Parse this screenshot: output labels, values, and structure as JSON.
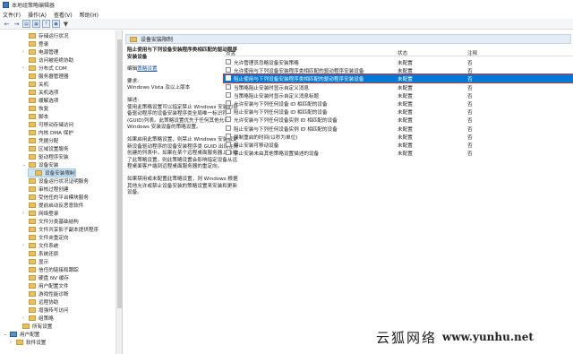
{
  "window": {
    "title": "本地组策略编辑器"
  },
  "menu": [
    "文件(F)",
    "操作(A)",
    "查看(V)",
    "帮助(H)"
  ],
  "toolbar": {
    "back": "←",
    "forward": "→",
    "box1": "▤",
    "box2": "▦",
    "help": "?",
    "box3": "▣",
    "filter": "▼"
  },
  "tree": {
    "items": [
      {
        "label": "存储运行状况",
        "depth": 3
      },
      {
        "label": "登录",
        "depth": 3
      },
      {
        "label": "电源管理",
        "depth": 3,
        "toggle": "›"
      },
      {
        "label": "访问被拒绝协助",
        "depth": 3
      },
      {
        "label": "分布式 COM",
        "depth": 3,
        "toggle": "›"
      },
      {
        "label": "服务器管理器",
        "depth": 3
      },
      {
        "label": "关机",
        "depth": 3
      },
      {
        "label": "关机选项",
        "depth": 3
      },
      {
        "label": "缓解选项",
        "depth": 3
      },
      {
        "label": "恢复",
        "depth": 3
      },
      {
        "label": "脚本",
        "depth": 3
      },
      {
        "label": "可移动存储访问",
        "depth": 3
      },
      {
        "label": "内核 DMA 保护",
        "depth": 3
      },
      {
        "label": "凭据分配",
        "depth": 3
      },
      {
        "label": "区域设置服务",
        "depth": 3
      },
      {
        "label": "驱动程序安装",
        "depth": 3
      },
      {
        "label": "设备安装",
        "depth": 3,
        "toggle": "⌄"
      },
      {
        "label": "设备安装限制",
        "depth": 4,
        "selected": true
      },
      {
        "label": "设备运行状况证明服务",
        "depth": 3
      },
      {
        "label": "审核过程创建",
        "depth": 3
      },
      {
        "label": "受信任的平台模块服务",
        "depth": 3
      },
      {
        "label": "提前启动反恶意软件",
        "depth": 3
      },
      {
        "label": "网络登录",
        "depth": 3,
        "toggle": "›"
      },
      {
        "label": "文件分类基础结构",
        "depth": 3
      },
      {
        "label": "文件共享影子副本提供程序",
        "depth": 3
      },
      {
        "label": "文件夹重定向",
        "depth": 3
      },
      {
        "label": "文件系统",
        "depth": 3,
        "toggle": "›"
      },
      {
        "label": "系统还原",
        "depth": 3
      },
      {
        "label": "显示",
        "depth": 3
      },
      {
        "label": "信任的链接和跟踪",
        "depth": 3
      },
      {
        "label": "硬盘 NV 缓存",
        "depth": 3
      },
      {
        "label": "用户配置文件",
        "depth": 3
      },
      {
        "label": "游戏性能诊断",
        "depth": 3
      },
      {
        "label": "远程协助",
        "depth": 3
      },
      {
        "label": "增强传写访问",
        "depth": 3
      },
      {
        "label": "组策略",
        "depth": 3,
        "toggle": "›"
      },
      {
        "label": "所有设置",
        "depth": 2
      },
      {
        "label": "用户配置",
        "depth": 0,
        "toggle": "⌄",
        "pc": true
      },
      {
        "label": "软件设置",
        "depth": 1,
        "toggle": "›"
      }
    ]
  },
  "content": {
    "header": "设备安装限制",
    "desc": {
      "title": "阻止使用与下列设备安装程序类相匹配的驱动程序安装设备",
      "edit_prefix": "编辑",
      "edit_link": "策略设置",
      "req_label": "要求:",
      "req_text": "Windows Vista 及以上版本",
      "desc_label": "描述:",
      "desc_text": "使用此策略设置可以指定禁止 Windows 安装的设备驱动程序的设备安装程序类全局唯一标识符(GUID)列表。此策略设置优先于任何其他允许 Windows 安装设备的策略设置。",
      "enable_text": "如果启用此策略设置，则禁止 Windows 安装或更新设备驱动程序的设备安装程序类 GUID 出现在你创建的列表中。如果在某个远程桌面服务器上启用了此策略设置，则此策略设置会影响指定设备从远程桌面客户端到远程桌面服务器的重定向。",
      "disable_text": "如果禁用或未配置此策略设置，则 Windows 根据其他允许或禁止设备安装的策略设置来安装和更新设备。"
    },
    "list": {
      "headers": {
        "setting": "设置",
        "state": "状态",
        "comment": "注释"
      },
      "rows": [
        {
          "name": "允许管理员忽略设备安装策略",
          "state": "未配置",
          "comment": "否"
        },
        {
          "name": "允许使用与下列设备安装程序类相匹配的驱动程序安装设备",
          "state": "未配置",
          "comment": "否"
        },
        {
          "name": "阻止使用与下列设备安装程序类相匹配的驱动程序安装设备",
          "state": "未配置",
          "comment": "否",
          "selected": true
        },
        {
          "name": "当策略阻止安装时显示自定义消息",
          "state": "未配置",
          "comment": "否"
        },
        {
          "name": "当策略阻止安装时显示自定义消息标题",
          "state": "未配置",
          "comment": "否"
        },
        {
          "name": "允许安装与下列任何设备 ID 相匹配的设备",
          "state": "未配置",
          "comment": "否"
        },
        {
          "name": "阻止安装与下列任何设备 ID 相匹配的设备",
          "state": "未配置",
          "comment": "否"
        },
        {
          "name": "允许安装与下列任何设备实例 ID 相匹配的设备",
          "state": "未配置",
          "comment": "否"
        },
        {
          "name": "阻止安装与下列任何设备实例 ID 相匹配的设备",
          "state": "未配置",
          "comment": "否"
        },
        {
          "name": "强制重启的时间(以秒为单位)",
          "state": "未配置",
          "comment": "否"
        },
        {
          "name": "禁止安装可移动设备",
          "state": "未配置",
          "comment": "否"
        },
        {
          "name": "禁止安装未由其他策略设置描述的设备",
          "state": "未配置",
          "comment": "否"
        }
      ]
    }
  },
  "watermark": {
    "brand": "云狐网络",
    "url": "www.yunhu.net"
  }
}
